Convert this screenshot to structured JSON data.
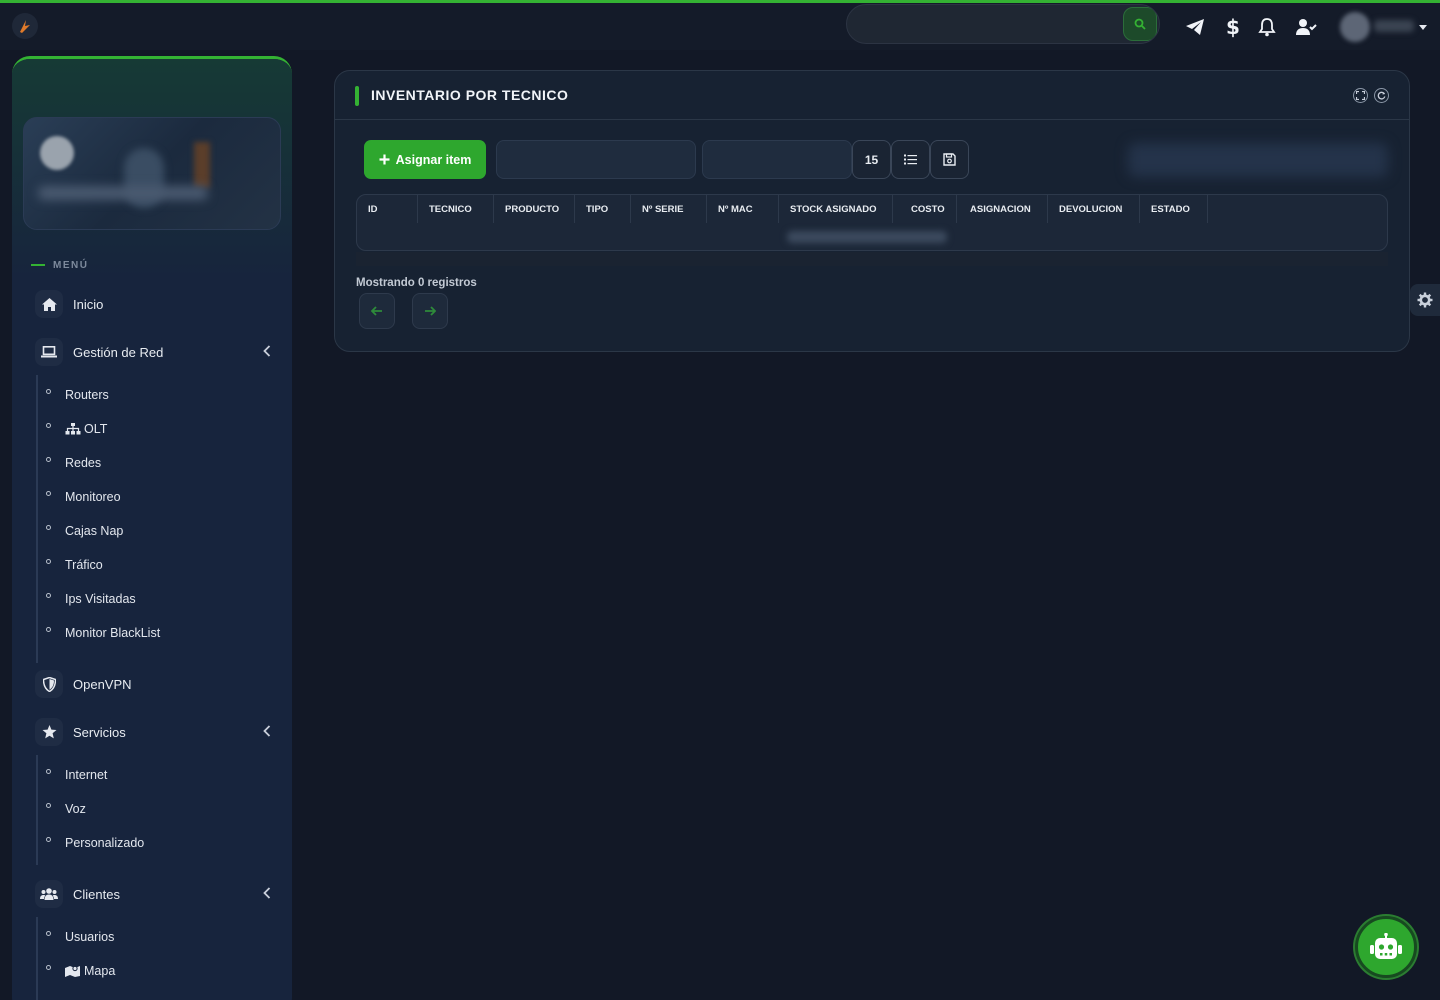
{
  "topbar": {
    "search_placeholder": "",
    "icons": [
      "telegram-icon",
      "dollar-icon",
      "bell-icon",
      "user-check-icon"
    ]
  },
  "sidebar": {
    "menu_label": "MENÚ",
    "items": [
      {
        "label": "Inicio",
        "icon": "home-icon"
      },
      {
        "label": "Gestión de Red",
        "icon": "laptop-icon",
        "subitems": [
          "Routers",
          "OLT",
          "Redes",
          "Monitoreo",
          "Cajas Nap",
          "Tráfico",
          "Ips Visitadas",
          "Monitor BlackList"
        ]
      },
      {
        "label": "OpenVPN",
        "icon": "shield-icon"
      },
      {
        "label": "Servicios",
        "icon": "star-icon",
        "subitems": [
          "Internet",
          "Voz",
          "Personalizado"
        ]
      },
      {
        "label": "Clientes",
        "icon": "users-icon",
        "subitems": [
          "Usuarios",
          "Mapa"
        ]
      }
    ]
  },
  "main": {
    "title": "INVENTARIO POR TECNICO",
    "assign_button": "Asignar item",
    "page_size": "15",
    "table": {
      "columns": [
        "ID",
        "TECNICO",
        "PRODUCTO",
        "TIPO",
        "Nº SERIE",
        "Nº MAC",
        "STOCK ASIGNADO",
        "COSTO",
        "ASIGNACION",
        "DEVOLUCION",
        "ESTADO"
      ]
    },
    "records_text": "Mostrando 0 registros"
  },
  "colors": {
    "accent": "#34b233",
    "background": "#121826",
    "sidebar": "#17243d",
    "card": "#172232"
  }
}
